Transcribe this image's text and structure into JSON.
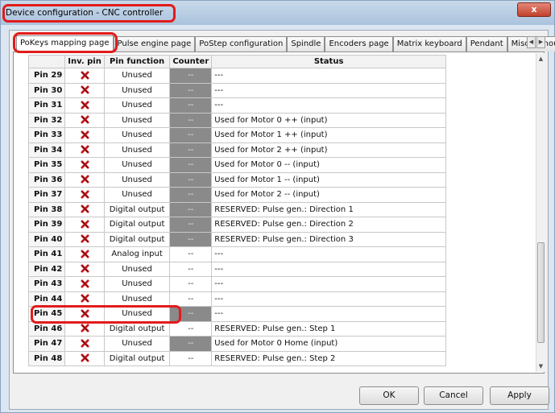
{
  "window": {
    "title": "Device configuration - CNC controller",
    "close_label": "x"
  },
  "tabs": [
    "PoKeys mapping page",
    "Pulse engine page",
    "PoStep configuration",
    "Spindle",
    "Encoders page",
    "Matrix keyboard",
    "Pendant",
    "Miscellenou"
  ],
  "tab_scroll": {
    "left": "◀",
    "right": "▶"
  },
  "columns": [
    "",
    "Inv. pin",
    "Pin function",
    "Counter",
    "Status"
  ],
  "rows": [
    {
      "pin": "Pin 29",
      "func": "Unused",
      "counter": "--",
      "grey": true,
      "status": "---"
    },
    {
      "pin": "Pin 30",
      "func": "Unused",
      "counter": "--",
      "grey": true,
      "status": "---"
    },
    {
      "pin": "Pin 31",
      "func": "Unused",
      "counter": "--",
      "grey": true,
      "status": "---"
    },
    {
      "pin": "Pin 32",
      "func": "Unused",
      "counter": "--",
      "grey": true,
      "status": "Used for Motor 0 ++ (input)"
    },
    {
      "pin": "Pin 33",
      "func": "Unused",
      "counter": "--",
      "grey": true,
      "status": "Used for Motor 1 ++ (input)"
    },
    {
      "pin": "Pin 34",
      "func": "Unused",
      "counter": "--",
      "grey": true,
      "status": "Used for Motor 2 ++ (input)"
    },
    {
      "pin": "Pin 35",
      "func": "Unused",
      "counter": "--",
      "grey": true,
      "status": "Used for Motor 0 -- (input)"
    },
    {
      "pin": "Pin 36",
      "func": "Unused",
      "counter": "--",
      "grey": true,
      "status": "Used for Motor 1 -- (input)"
    },
    {
      "pin": "Pin 37",
      "func": "Unused",
      "counter": "--",
      "grey": true,
      "status": "Used for Motor 2 -- (input)"
    },
    {
      "pin": "Pin 38",
      "func": "Digital output",
      "counter": "--",
      "grey": true,
      "status": "RESERVED: Pulse gen.: Direction 1"
    },
    {
      "pin": "Pin 39",
      "func": "Digital output",
      "counter": "--",
      "grey": true,
      "status": "RESERVED: Pulse gen.: Direction 2"
    },
    {
      "pin": "Pin 40",
      "func": "Digital output",
      "counter": "--",
      "grey": true,
      "status": "RESERVED: Pulse gen.: Direction 3"
    },
    {
      "pin": "Pin 41",
      "func": "Analog input",
      "counter": "--",
      "grey": false,
      "status": "---"
    },
    {
      "pin": "Pin 42",
      "func": "Unused",
      "counter": "--",
      "grey": false,
      "status": "---"
    },
    {
      "pin": "Pin 43",
      "func": "Unused",
      "counter": "--",
      "grey": false,
      "status": "---"
    },
    {
      "pin": "Pin 44",
      "func": "Unused",
      "counter": "--",
      "grey": false,
      "status": "---"
    },
    {
      "pin": "Pin 45",
      "func": "Unused",
      "counter": "--",
      "grey": true,
      "status": "---"
    },
    {
      "pin": "Pin 46",
      "func": "Digital output",
      "counter": "--",
      "grey": false,
      "status": "RESERVED: Pulse gen.: Step 1"
    },
    {
      "pin": "Pin 47",
      "func": "Unused",
      "counter": "--",
      "grey": true,
      "status": "Used for Motor 0 Home (input)"
    },
    {
      "pin": "Pin 48",
      "func": "Digital output",
      "counter": "--",
      "grey": false,
      "status": "RESERVED: Pulse gen.: Step 2"
    }
  ],
  "inv_pin_icon": "red-x-icon",
  "buttons": {
    "ok": "OK",
    "cancel": "Cancel",
    "apply": "Apply"
  },
  "colors": {
    "highlight": "#e21b1b",
    "counter_grey": "#8a8a8a"
  }
}
